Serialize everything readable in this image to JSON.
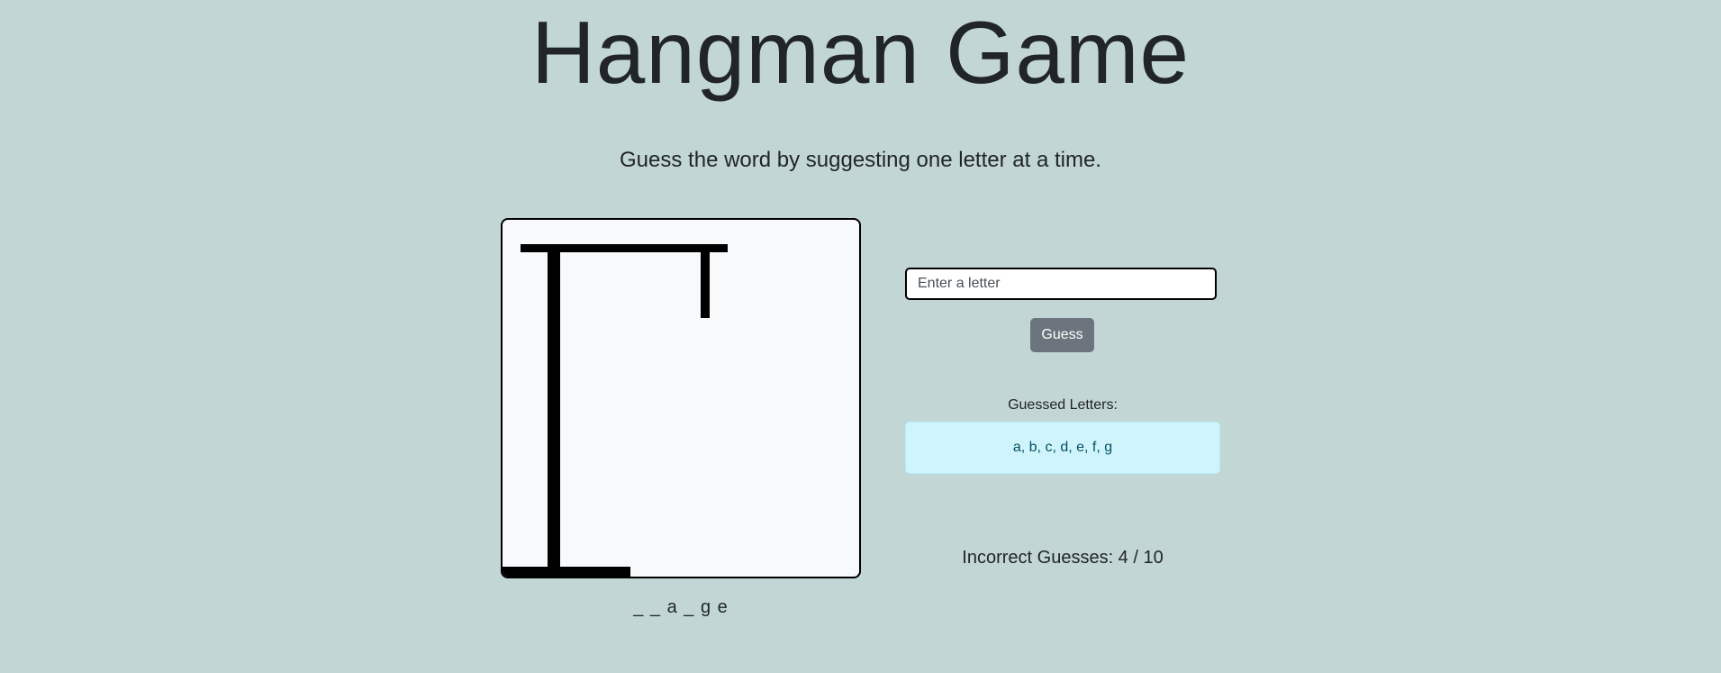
{
  "header": {
    "title": "Hangman Game",
    "subtitle": "Guess the word by suggesting one letter at a time."
  },
  "game": {
    "word_display": "_ _ a _ g e",
    "input_placeholder": "Enter a letter",
    "guess_button_label": "Guess",
    "guessed_letters_label": "Guessed Letters:",
    "guessed_letters": "a, b, c, d, e, f, g",
    "incorrect_guesses_text": "Incorrect Guesses: 4 / 10",
    "incorrect_count": 4,
    "max_incorrect": 10
  },
  "colors": {
    "background": "#c2d6d6",
    "board": "#f8f9fa",
    "button": "#6c757d",
    "guessed_box": "#cff4fc"
  }
}
